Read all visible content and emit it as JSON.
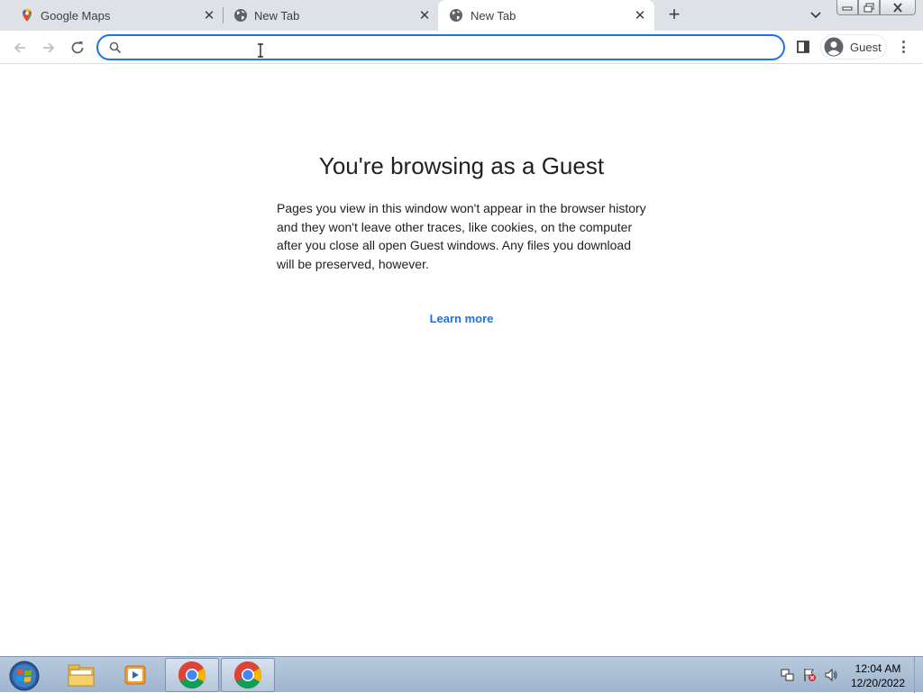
{
  "tabs": [
    {
      "title": "Google Maps",
      "icon": "google-maps-icon",
      "active": false
    },
    {
      "title": "New Tab",
      "icon": "globe-icon",
      "active": false
    },
    {
      "title": "New Tab",
      "icon": "globe-icon",
      "active": true
    }
  ],
  "toolbar": {
    "omnibox_value": "",
    "profile_label": "Guest"
  },
  "content": {
    "title": "You're browsing as a Guest",
    "description": "Pages you view in this window won't appear in the browser history and they won't leave other traces, like cookies, on the computer after you close all open Guest windows. Any files you download will be preserved, however.",
    "learn_more": "Learn more"
  },
  "taskbar": {
    "time": "12:04 AM",
    "date": "12/20/2022",
    "items": [
      "start-orb",
      "file-explorer-icon",
      "media-player-icon",
      "chrome-icon",
      "chrome-icon"
    ]
  },
  "colors": {
    "accent": "#1a73e8",
    "tabstrip": "#dee1e6",
    "text": "#202124"
  }
}
